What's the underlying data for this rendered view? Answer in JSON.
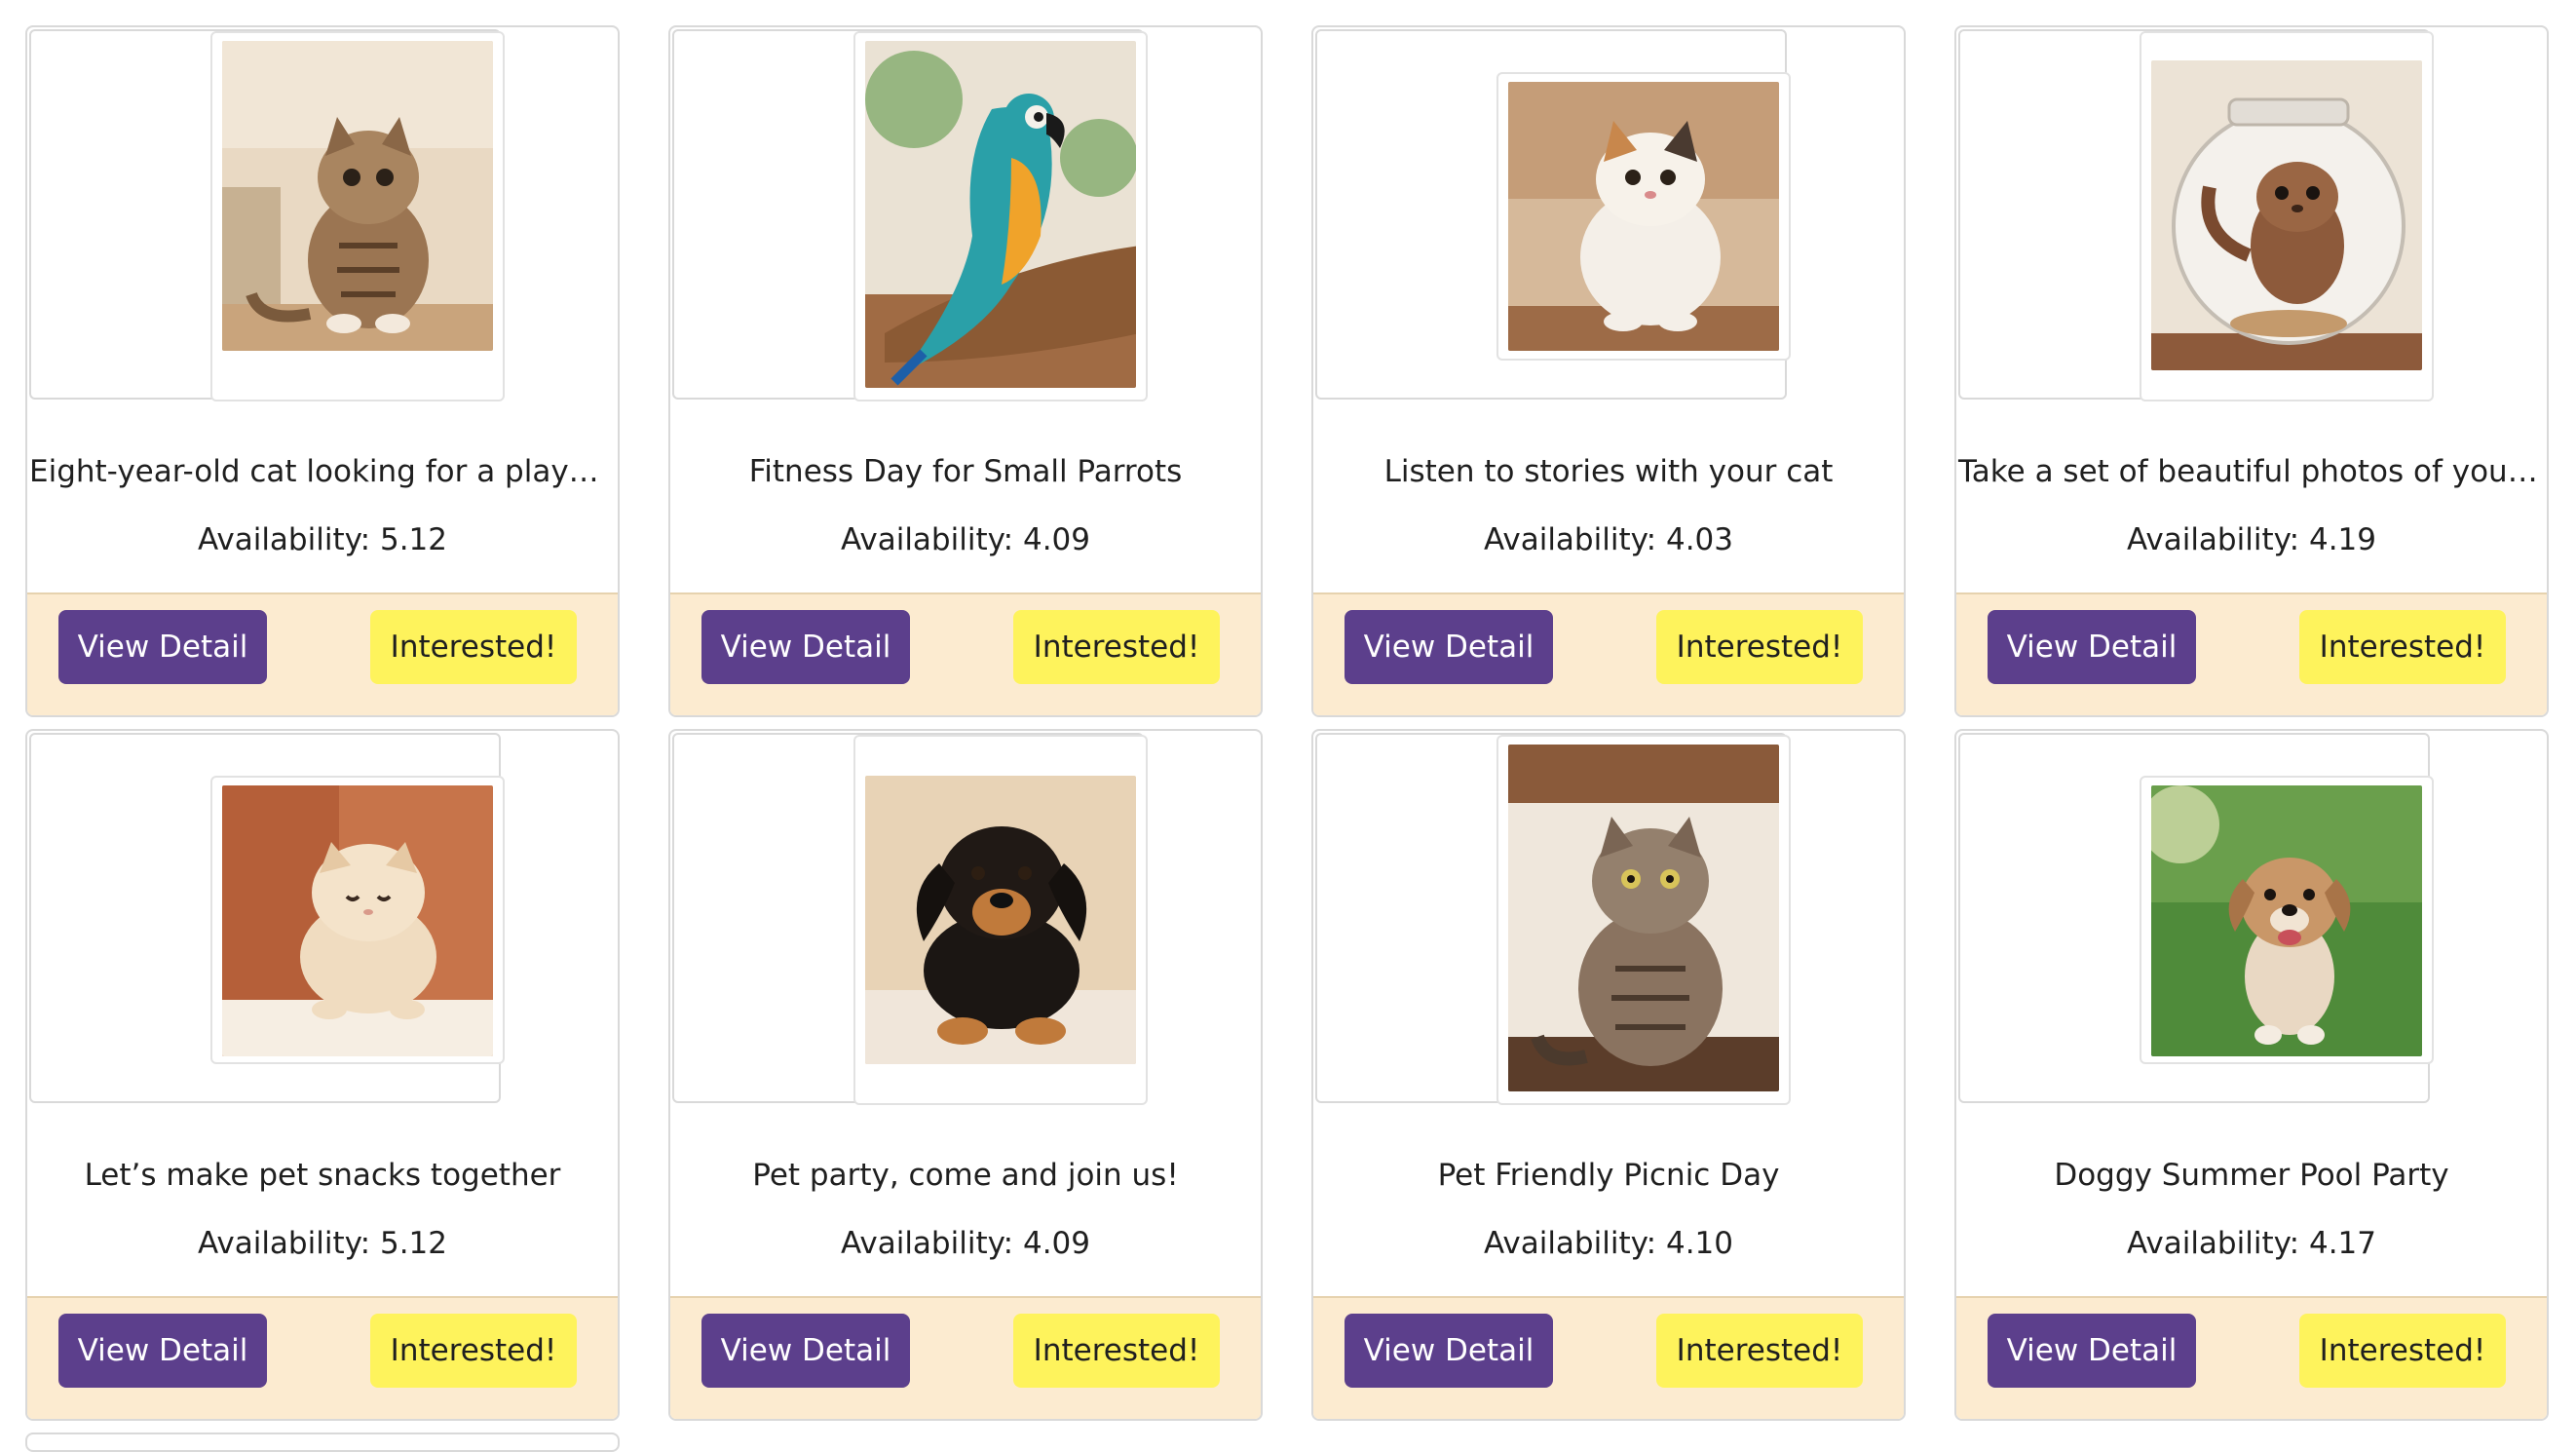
{
  "labels": {
    "availability_prefix": "Availability: ",
    "view_detail": "View Detail",
    "interested": "Interested!"
  },
  "cards": [
    {
      "title": "Eight-year-old cat looking for a playma...",
      "availability": "Availability: 5.12",
      "view_label": "View Detail",
      "interest_label": "Interested!",
      "photo_subject": "tabby-kitten",
      "photo_colors": [
        "#c9a47c",
        "#7a5a3c",
        "#e9d9c3"
      ]
    },
    {
      "title": "Fitness Day for Small Parrots",
      "availability": "Availability: 4.09",
      "view_label": "View Detail",
      "interest_label": "Interested!",
      "photo_subject": "blue-gold-macaw",
      "photo_colors": [
        "#2aa0a8",
        "#f0a32a",
        "#8b5a34"
      ]
    },
    {
      "title": "Listen to stories with your cat",
      "availability": "Availability: 4.03",
      "view_label": "View Detail",
      "interest_label": "Interested!",
      "photo_subject": "white-calico-cat",
      "photo_colors": [
        "#f4efe8",
        "#c8874c",
        "#9d6b47"
      ]
    },
    {
      "title": "Take a set of beautiful photos of your pet",
      "availability": "Availability: 4.19",
      "view_label": "View Detail",
      "interest_label": "Interested!",
      "photo_subject": "ferret-in-fishbowl",
      "photo_colors": [
        "#8d5a3b",
        "#d9d2c8",
        "#c49a6c"
      ]
    },
    {
      "title": "Let’s make pet snacks together",
      "availability": "Availability: 5.12",
      "view_label": "View Detail",
      "interest_label": "Interested!",
      "photo_subject": "cream-kitten",
      "photo_colors": [
        "#f0dcc0",
        "#a8522f",
        "#f6eee3"
      ]
    },
    {
      "title": "Pet party, come and join us!",
      "availability": "Availability: 4.09",
      "view_label": "View Detail",
      "interest_label": "Interested!",
      "photo_subject": "black-tan-puppy",
      "photo_colors": [
        "#1b1613",
        "#c07a3b",
        "#f0e6da"
      ]
    },
    {
      "title": "Pet Friendly Picnic Day",
      "availability": "Availability: 4.10",
      "view_label": "View Detail",
      "interest_label": "Interested!",
      "photo_subject": "tabby-cat-sitting",
      "photo_colors": [
        "#8a7360",
        "#5b3d2a",
        "#efe7dc"
      ]
    },
    {
      "title": "Doggy Summer Pool Party",
      "availability": "Availability: 4.17",
      "view_label": "View Detail",
      "interest_label": "Interested!",
      "photo_subject": "terrier-dog-in-park",
      "photo_colors": [
        "#4f8b3a",
        "#c99768",
        "#a7cfe9"
      ]
    }
  ],
  "colors": {
    "view_button": "#5c3f8c",
    "interested_button": "#fef35c",
    "footer_bg": "#fcebd0",
    "card_border": "#d9d9d9"
  }
}
